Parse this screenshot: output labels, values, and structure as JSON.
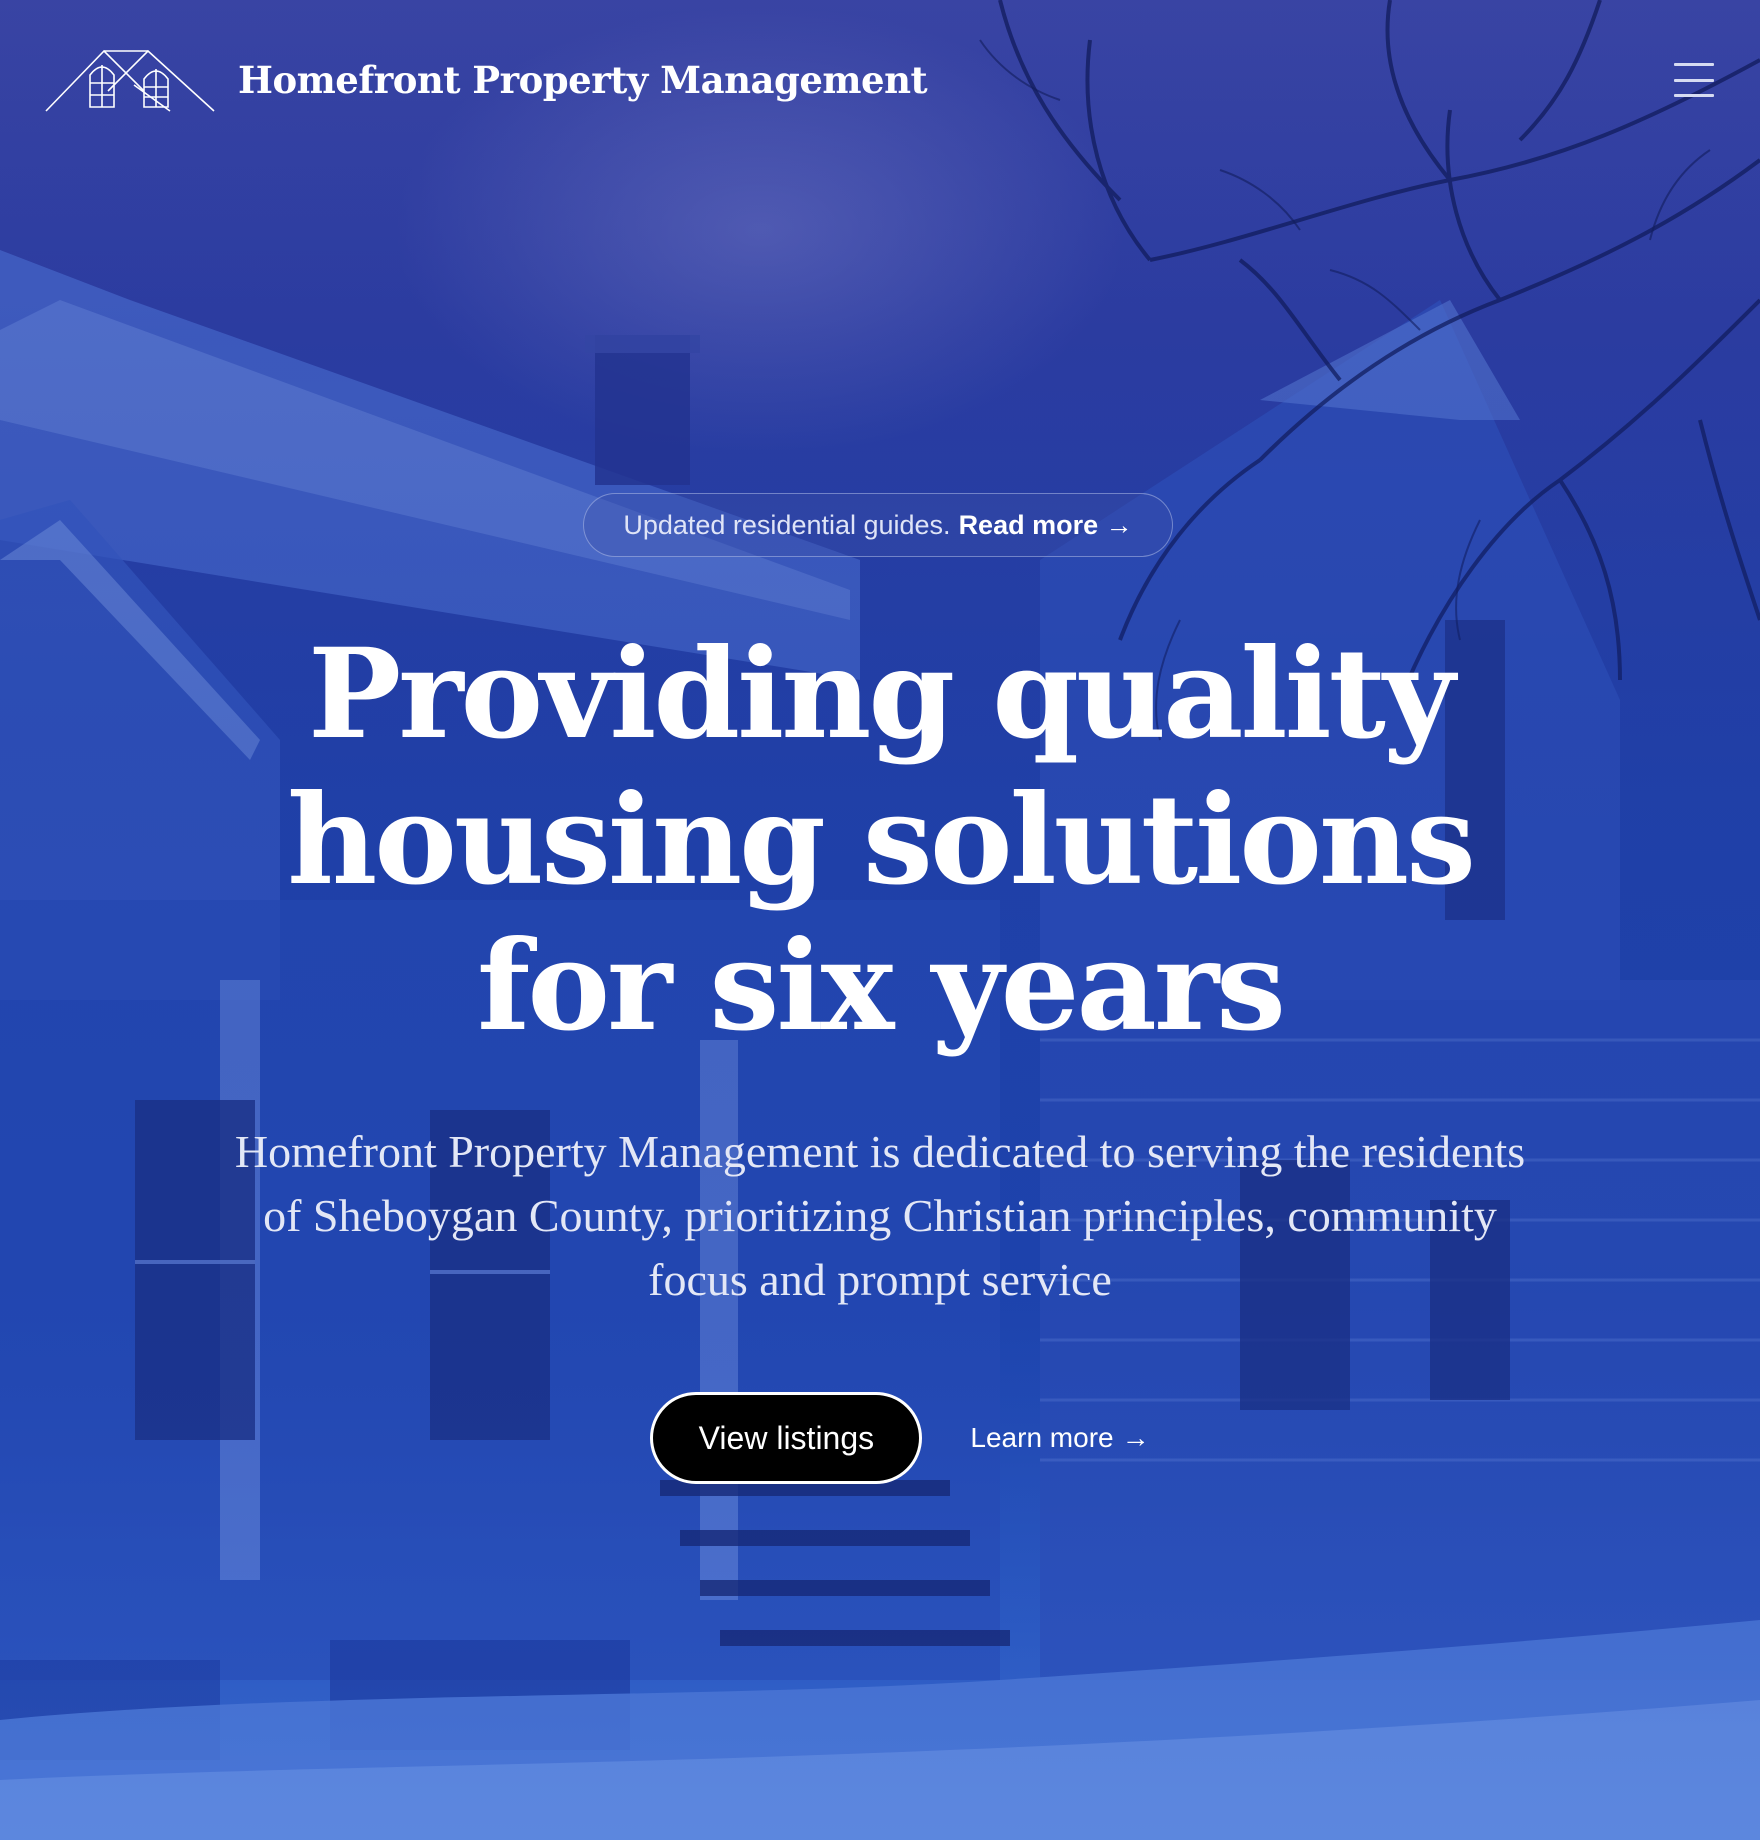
{
  "header": {
    "brand_name": "Homefront Property Management",
    "logo_icon": "house-outline-logo",
    "menu_icon": "hamburger-menu-icon"
  },
  "announcement": {
    "text": "Updated residential guides.",
    "link_label": "Read more",
    "arrow": "→"
  },
  "hero": {
    "headline_lines": [
      "Providing quality",
      "housing solutions",
      "for six years"
    ],
    "subtitle_lines": [
      "Homefront Property Management is dedicated to serving the residents",
      "of Sheboygan County, prioritizing Christian principles, community",
      "focus and prompt service"
    ],
    "primary_button": "View listings",
    "secondary_link": "Learn more",
    "secondary_arrow": "→"
  },
  "colors": {
    "background": "#2346ad",
    "text": "#ffffff",
    "button_bg": "#000000"
  }
}
